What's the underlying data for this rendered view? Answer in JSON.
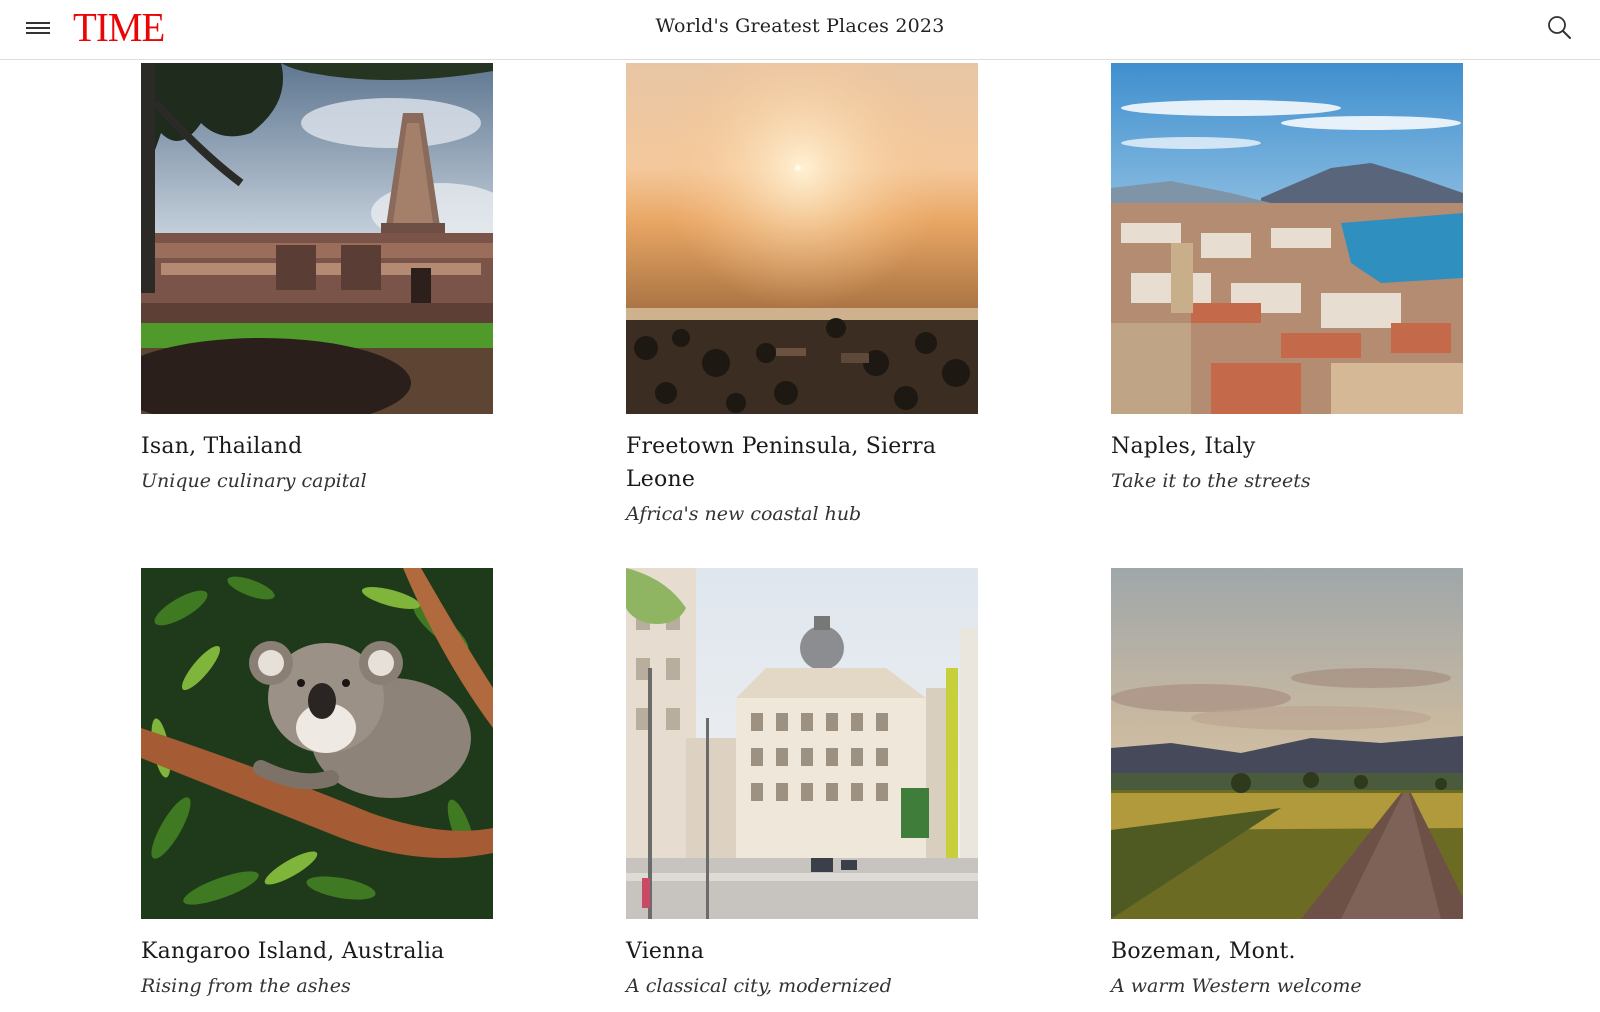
{
  "header": {
    "logo": "TIME",
    "title": "World's Greatest Places 2023",
    "menu_icon": "hamburger-menu-icon",
    "search_icon": "search-icon",
    "brand_color": "#e90606"
  },
  "places": [
    {
      "name": "Isan, Thailand",
      "tagline": "Unique culinary capital",
      "image": "khmer-temple-photo"
    },
    {
      "name": "Freetown Peninsula, Sierra Leone",
      "tagline": "Africa's new coastal hub",
      "image": "coastal-sunset-photo"
    },
    {
      "name": "Naples, Italy",
      "tagline": "Take it to the streets",
      "image": "naples-bay-vesuvius-photo"
    },
    {
      "name": "Kangaroo Island, Australia",
      "tagline": "Rising from the ashes",
      "image": "koala-in-tree-photo"
    },
    {
      "name": "Vienna",
      "tagline": "A classical city, modernized",
      "image": "vienna-building-photo"
    },
    {
      "name": "Bozeman, Mont.",
      "tagline": "A warm Western welcome",
      "image": "montana-road-photo"
    }
  ]
}
